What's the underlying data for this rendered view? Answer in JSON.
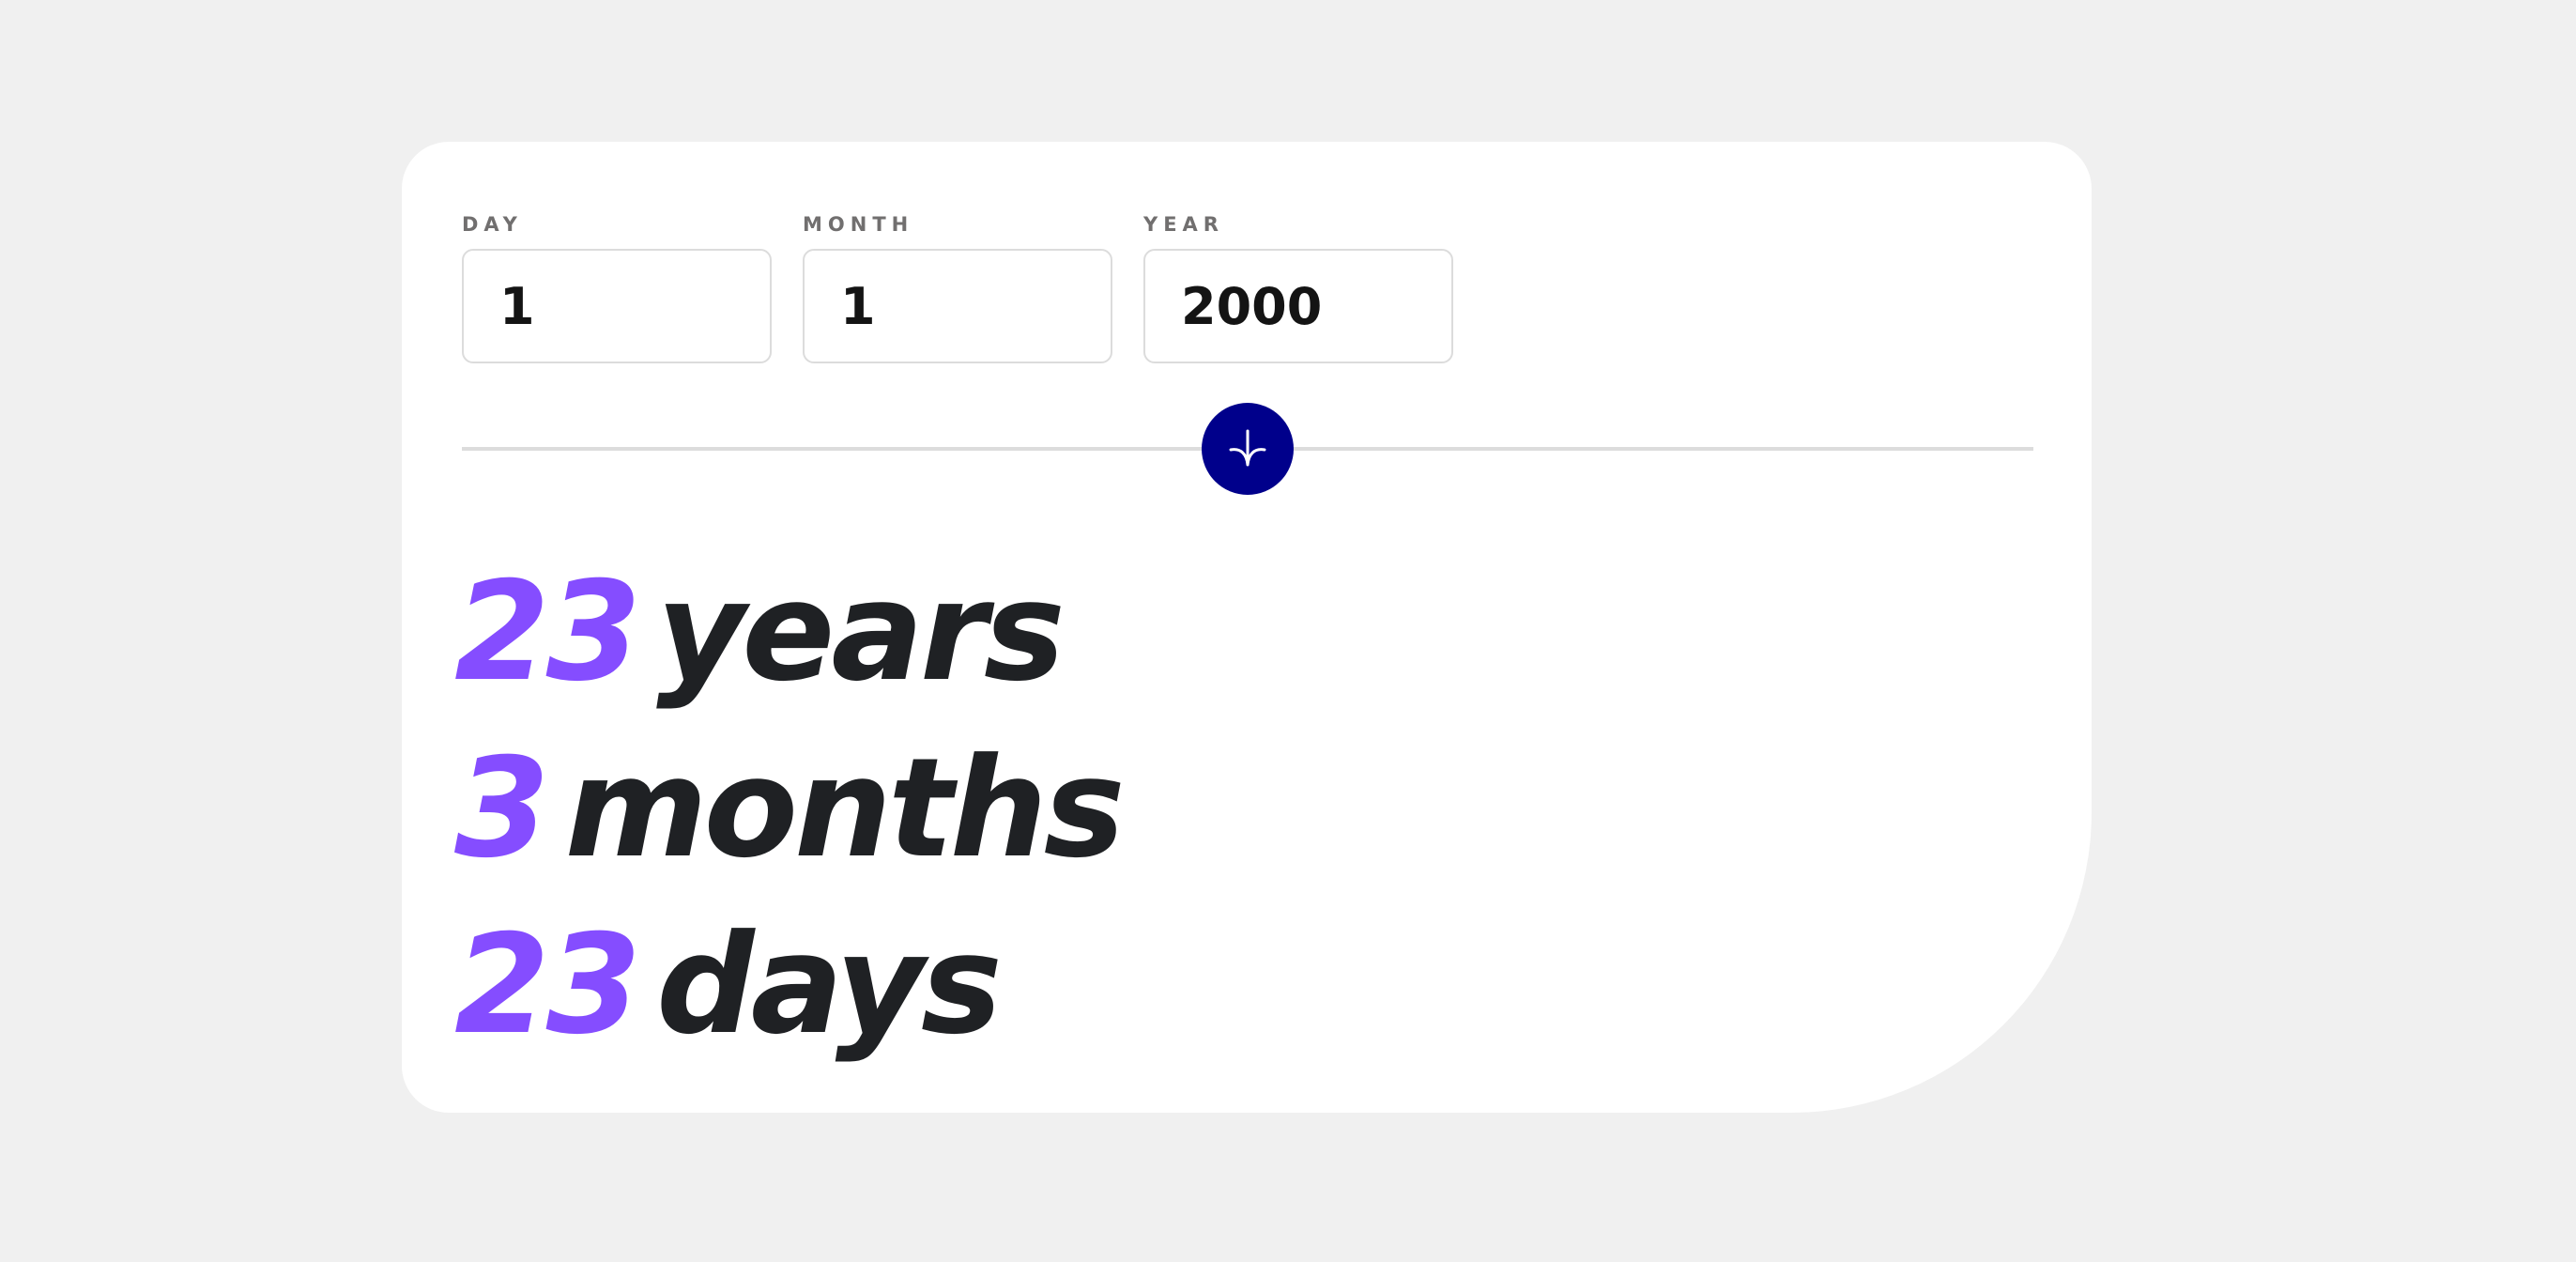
{
  "form": {
    "day": {
      "label": "DAY",
      "value": "1"
    },
    "month": {
      "label": "MONTH",
      "value": "1"
    },
    "year": {
      "label": "YEAR",
      "value": "2000"
    }
  },
  "submit": {
    "icon": "arrow-down-icon",
    "color": "#00008b"
  },
  "results": {
    "years": {
      "value": "23",
      "unit": "years"
    },
    "months": {
      "value": "3",
      "unit": "months"
    },
    "days": {
      "value": "23",
      "unit": "days"
    }
  },
  "colors": {
    "accent": "#854dff",
    "background": "#f0f0f0",
    "card": "#ffffff",
    "text": "#1f2124",
    "label": "#716f6f"
  }
}
